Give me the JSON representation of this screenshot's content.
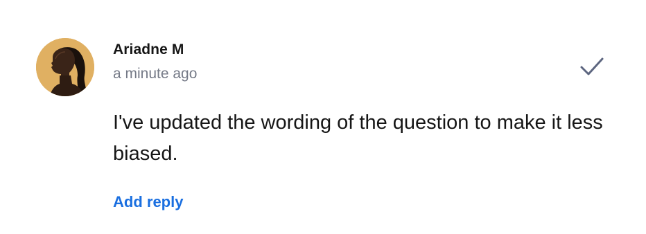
{
  "comment": {
    "author": "Ariadne M",
    "timestamp": "a minute ago",
    "body": "I've updated the wording of the question to make it less biased.",
    "reply_label": "Add reply",
    "resolve_icon": "check-icon",
    "avatar_icon": "avatar-portrait",
    "colors": {
      "author_text": "#161616",
      "timestamp_text": "#757a87",
      "link": "#1a6fe0",
      "check": "#5d6680",
      "avatar_background": "#e0b062"
    }
  }
}
